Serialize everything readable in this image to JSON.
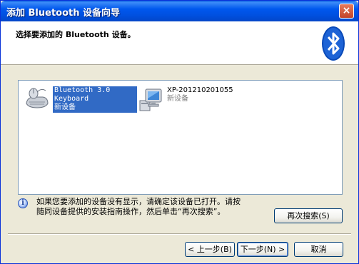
{
  "window": {
    "title": "添加 Bluetooth 设备向导",
    "close_symbol": "×"
  },
  "header": {
    "instruction": "选择要添加的 Bluetooth 设备。"
  },
  "devices": [
    {
      "name_line1": "Bluetooth 3.0",
      "name_line2": "Keyboard",
      "status": "新设备",
      "icon": "keyboard-mouse-icon",
      "selected": true
    },
    {
      "name_line1": "XP-201210201055",
      "status": "新设备",
      "icon": "computer-icon",
      "selected": false
    }
  ],
  "info": {
    "icon": "info-icon",
    "line1": "如果您要添加的设备没有显示，请确定该设备已打开。请按",
    "line2": "随同设备提供的安装指南操作，然后单击“再次搜索”。"
  },
  "buttons": {
    "rescan": "再次搜索(S)",
    "back": "< 上一步(B)",
    "next": "下一步(N) >",
    "cancel": "取消"
  },
  "colors": {
    "title_bar": "#0054E3",
    "selection": "#316AC5",
    "dialog_bg": "#ECE9D8",
    "bluetooth_blue": "#0A4AB8"
  }
}
